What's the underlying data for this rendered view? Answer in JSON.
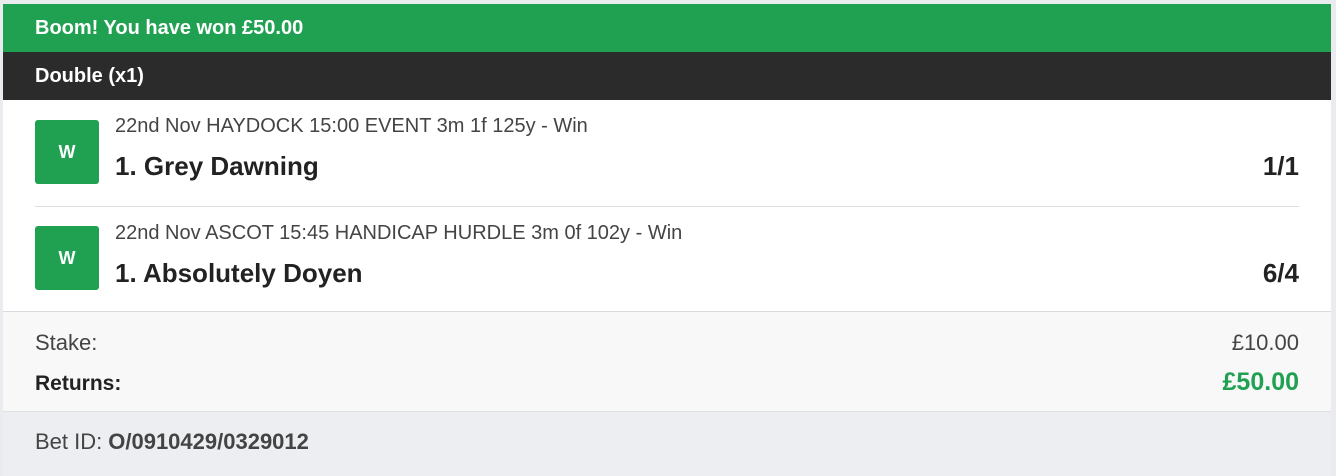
{
  "banner": {
    "text": "Boom! You have won £50.00"
  },
  "bet_type": {
    "label": "Double (x1)"
  },
  "selections": [
    {
      "result": "W",
      "event": "22nd Nov HAYDOCK 15:00 EVENT 3m 1f 125y - Win",
      "runner": "1. Grey Dawning",
      "odds": "1/1"
    },
    {
      "result": "W",
      "event": "22nd Nov ASCOT 15:45 HANDICAP HURDLE 3m 0f 102y - Win",
      "runner": "1. Absolutely Doyen",
      "odds": "6/4"
    }
  ],
  "summary": {
    "stake_label": "Stake:",
    "stake_value": "£10.00",
    "returns_label": "Returns:",
    "returns_value": "£50.00"
  },
  "footer": {
    "bet_id_label": "Bet ID:",
    "bet_id_value": "O/0910429/0329012"
  },
  "colors": {
    "win_green": "#20a152",
    "header_dark": "#2b2b2b"
  }
}
